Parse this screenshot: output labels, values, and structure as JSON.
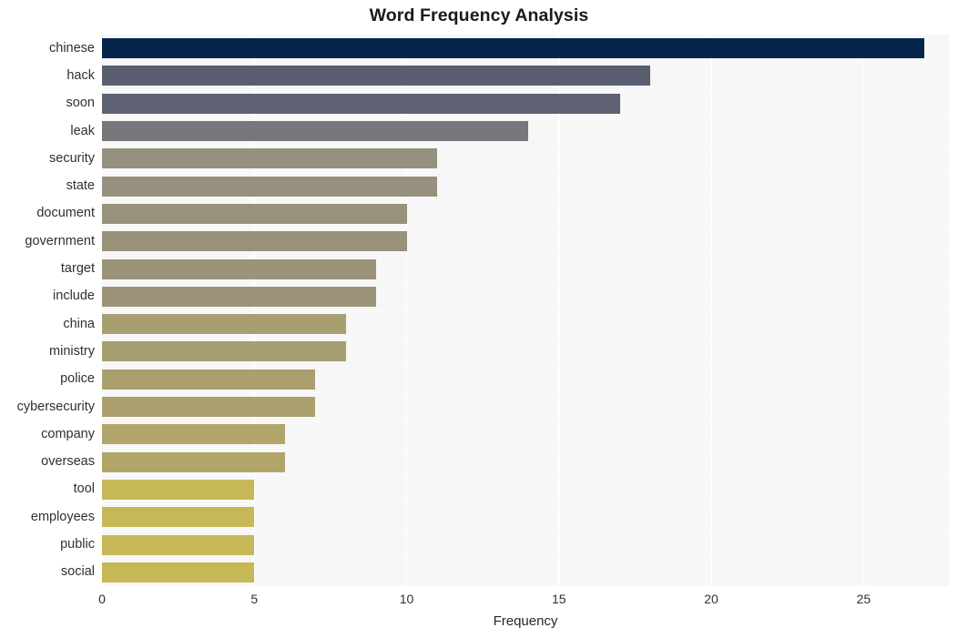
{
  "chart_data": {
    "type": "bar",
    "orientation": "horizontal",
    "title": "Word Frequency Analysis",
    "xlabel": "Frequency",
    "ylabel": "",
    "categories": [
      "chinese",
      "hack",
      "soon",
      "leak",
      "security",
      "state",
      "document",
      "government",
      "target",
      "include",
      "china",
      "ministry",
      "police",
      "cybersecurity",
      "company",
      "overseas",
      "tool",
      "employees",
      "public",
      "social"
    ],
    "values": [
      27,
      18,
      17,
      14,
      11,
      11,
      10,
      10,
      9,
      9,
      8,
      8,
      7,
      7,
      6,
      6,
      5,
      5,
      5,
      5
    ],
    "bar_colors": [
      "#03254c",
      "#585d70",
      "#5e6273",
      "#76777a",
      "#95917e",
      "#95917e",
      "#98927a",
      "#98927a",
      "#9c9478",
      "#9c9478",
      "#a79e72",
      "#a79e72",
      "#ab9f6e",
      "#ab9f6e",
      "#b2a569",
      "#b2a569",
      "#c6b757",
      "#c6b757",
      "#c6b757",
      "#c6b757"
    ],
    "xlim": [
      0,
      27.8
    ],
    "xticks": [
      0,
      5,
      10,
      15,
      20,
      25
    ],
    "xtick_labels": [
      "0",
      "5",
      "10",
      "15",
      "20",
      "25"
    ],
    "grid": "vertical",
    "legend": "none",
    "plot_background": "#f7f7f7",
    "figure_background": "#ffffff",
    "gridline_color": "#ffffff"
  }
}
